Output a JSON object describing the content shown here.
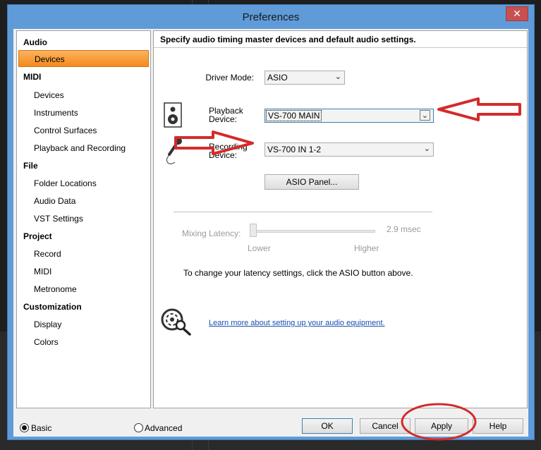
{
  "window": {
    "title": "Preferences",
    "close_glyph": "✕"
  },
  "nav": {
    "groups": [
      {
        "label": "Audio",
        "items": [
          "Devices"
        ]
      },
      {
        "label": "MIDI",
        "items": [
          "Devices",
          "Instruments",
          "Control Surfaces",
          "Playback and Recording"
        ]
      },
      {
        "label": "File",
        "items": [
          "Folder Locations",
          "Audio Data",
          "VST Settings"
        ]
      },
      {
        "label": "Project",
        "items": [
          "Record",
          "MIDI",
          "Metronome"
        ]
      },
      {
        "label": "Customization",
        "items": [
          "Display",
          "Colors"
        ]
      }
    ],
    "selected": "Audio/Devices"
  },
  "panel": {
    "header": "Specify audio timing master devices and default audio settings.",
    "driver_mode": {
      "label": "Driver Mode:",
      "value": "ASIO"
    },
    "playback_device": {
      "label_line1": "Playback",
      "label_line2": "Device:",
      "value": "VS-700 MAIN"
    },
    "recording_device": {
      "label_line1": "Recording",
      "label_line2": "Device:",
      "value": "VS-700 IN 1-2"
    },
    "asio_panel_button": "ASIO Panel...",
    "mixing_latency": {
      "label": "Mixing Latency:",
      "value": "2.9 msec",
      "lower": "Lower",
      "higher": "Higher",
      "level_fraction": 0.0
    },
    "latency_note": "To change your latency settings, click the ASIO button above.",
    "learn_more_link": "Learn more about setting up your audio equipment."
  },
  "footer": {
    "mode_basic": "Basic",
    "mode_advanced": "Advanced",
    "selected_mode": "Basic",
    "ok": "OK",
    "cancel": "Cancel",
    "apply": "Apply",
    "help": "Help"
  },
  "icons": {
    "speaker": "speaker-icon",
    "microphone": "microphone-icon",
    "help_magnifier": "help-magnifier-icon",
    "dropdown_arrow": "chevron-down-icon"
  },
  "colors": {
    "annotation_red": "#d42a2a",
    "selected_nav": "#f48a1c",
    "titlebar": "#5f9bd8"
  }
}
